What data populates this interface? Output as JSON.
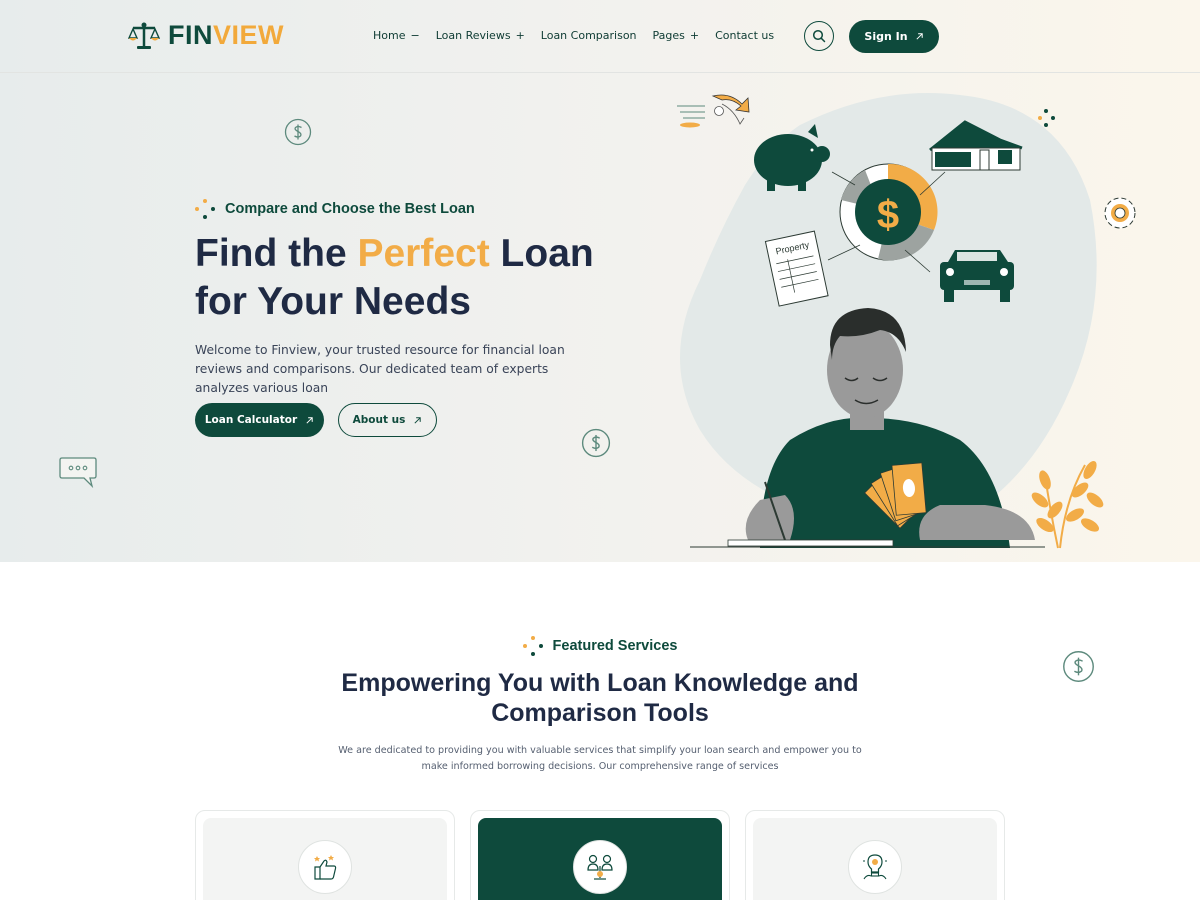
{
  "brand": {
    "name_part1": "FIN",
    "name_part2": "VIEW"
  },
  "nav": {
    "items": [
      {
        "label": "Home",
        "symbol": "−"
      },
      {
        "label": "Loan Reviews",
        "symbol": "+"
      },
      {
        "label": "Loan Comparison",
        "symbol": ""
      },
      {
        "label": "Pages",
        "symbol": "+"
      },
      {
        "label": "Contact us",
        "symbol": ""
      }
    ],
    "search_icon": "search-icon",
    "signin_label": "Sign In"
  },
  "hero": {
    "eyebrow": "Compare and Choose the Best Loan",
    "title_part1": "Find the ",
    "title_accent": "Perfect",
    "title_part2": " Loan for Your Needs",
    "description": "Welcome to Finview, your trusted resource for financial loan reviews and comparisons. Our dedicated team of experts analyzes various loan",
    "primary_button": "Loan Calculator",
    "secondary_button": "About us",
    "illustration_label": "Property"
  },
  "featured": {
    "eyebrow": "Featured Services",
    "title": "Empowering You with Loan Knowledge and Comparison Tools",
    "description": "We are dedicated to providing you with valuable services that simplify your loan search and empower you to make informed borrowing decisions. Our comprehensive range of services",
    "cards": [
      {
        "icon": "thumbs-up-stars-icon"
      },
      {
        "icon": "people-balance-icon"
      },
      {
        "icon": "lightbulb-idea-icon"
      }
    ]
  },
  "colors": {
    "primary": "#0e4a3c",
    "accent": "#f2ac47",
    "text_dark": "#1f2a44"
  }
}
